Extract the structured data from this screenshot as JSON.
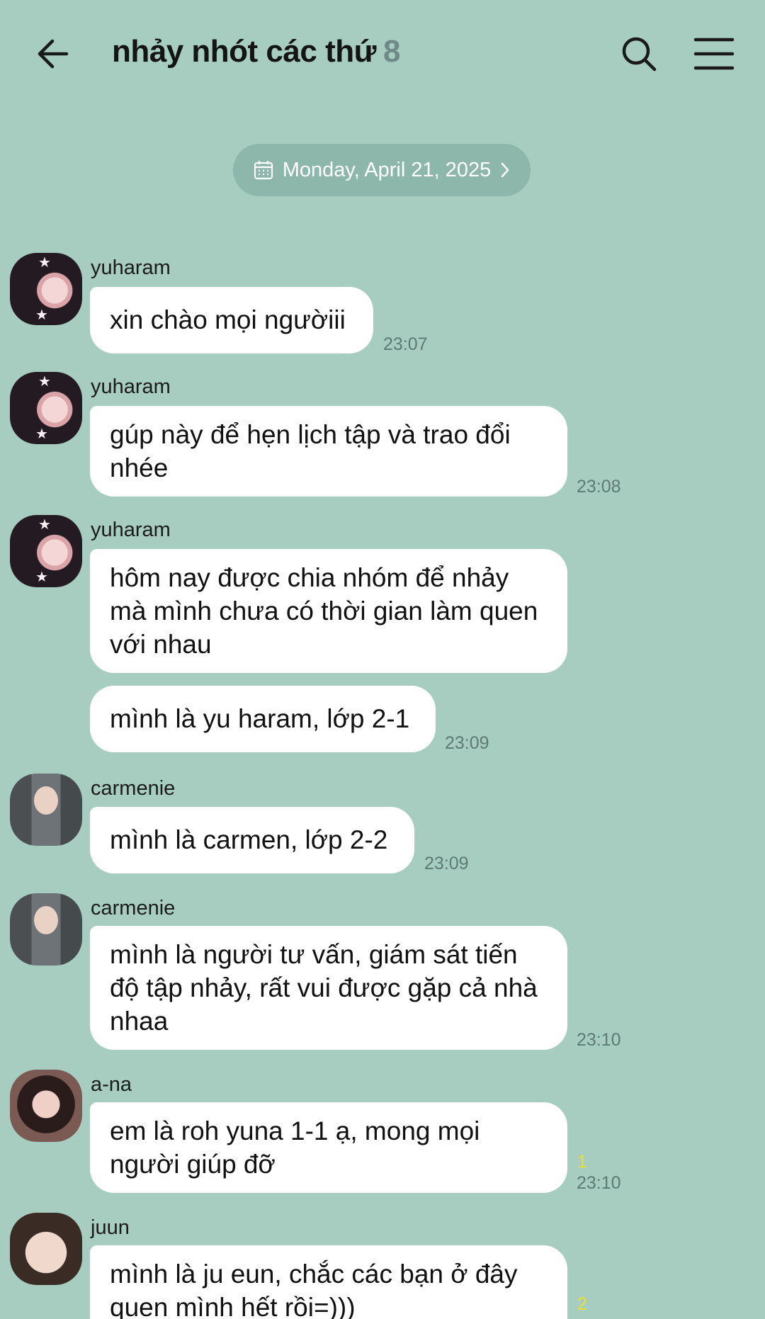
{
  "header": {
    "title": "nhảy nhót các thứ",
    "member_count": "8"
  },
  "date_divider": "Monday, April 21, 2025",
  "messages": [
    {
      "sender": "yuharam",
      "text": "xin chào mọi ngườiii",
      "time": "23:07"
    },
    {
      "sender": "yuharam",
      "text": "gúp này để hẹn lịch tập và trao đổi nhée",
      "time": "23:08"
    },
    {
      "sender": "yuharam",
      "text": "hôm nay được chia nhóm để nhảy mà mình chưa có thời gian làm quen với nhau"
    },
    {
      "text": "mình là yu haram, lớp 2-1",
      "time": "23:09"
    },
    {
      "sender": "carmenie",
      "text": "mình là carmen, lớp 2-2",
      "time": "23:09"
    },
    {
      "sender": "carmenie",
      "text": "mình là người tư vấn, giám sát tiến độ tập nhảy, rất vui được gặp cả nhà nhaa",
      "time": "23:10"
    },
    {
      "sender": "a-na",
      "text": "em là roh yuna 1-1 ạ, mong mọi người giúp đỡ",
      "unread": "1",
      "time": "23:10"
    },
    {
      "sender": "juun",
      "text": "mình là ju eun, chắc các bạn ở đây quen mình hết rồi=)))",
      "unread": "2"
    }
  ],
  "icons": [
    "back-arrow-icon",
    "search-icon",
    "menu-icon",
    "calendar-icon",
    "chevron-right-icon"
  ],
  "colors": {
    "background": "#a6cdc0",
    "bubble": "#ffffff",
    "unread": "#e8e02e"
  }
}
